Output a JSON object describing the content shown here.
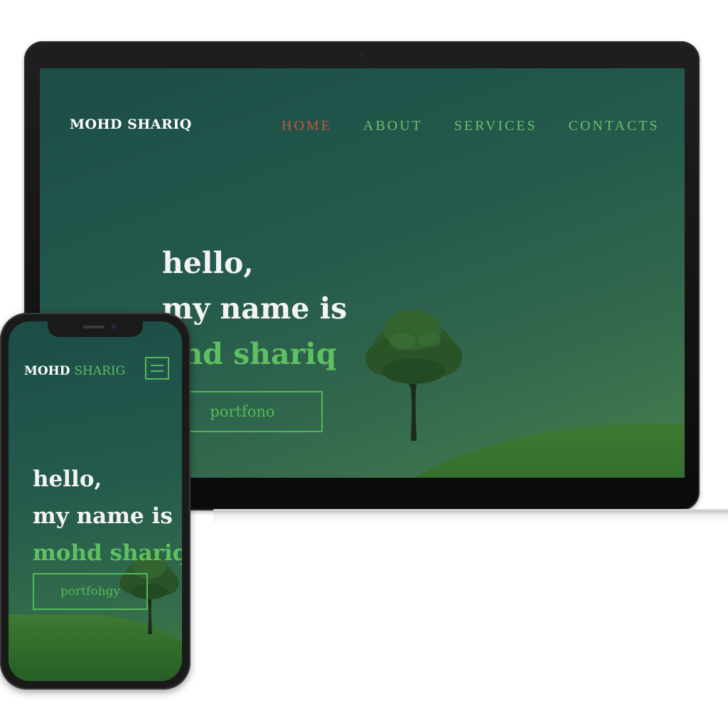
{
  "desktop": {
    "brand": "MOHD SHARIQ",
    "nav": [
      {
        "label": "HOME",
        "active": true
      },
      {
        "label": "ABOUT",
        "active": false
      },
      {
        "label": "SERVICES",
        "active": false
      },
      {
        "label": "CONTACTS",
        "active": false
      }
    ],
    "hero": {
      "line1": "hello,",
      "line2": "my name is",
      "line3": "ohd shariq"
    },
    "cta_label": "portfono"
  },
  "mobile": {
    "brand_part1": "MOHD",
    "brand_part2": "SHARIG",
    "menu_icon": "hamburger-menu-icon",
    "hero": {
      "line1": "hello,",
      "line2": "my name is",
      "line3": "mohd shariq"
    },
    "cta_label": "portfohgy"
  },
  "colors": {
    "background_top": "#1c4d47",
    "background_bottom": "#4b7e4d",
    "accent_green": "#5fbf62",
    "nav_green": "#6bbf6b",
    "active_nav": "#c0583b",
    "text_light": "#f3f3f3",
    "device_frame": "#1a1a1a"
  }
}
